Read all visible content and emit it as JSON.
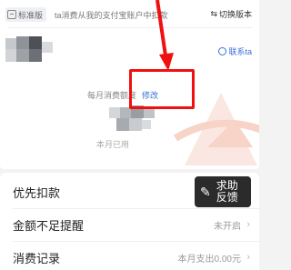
{
  "header": {
    "badge": "标准版",
    "description": "ta消费从我的支付宝账户中扣款",
    "switch_label": "切换版本"
  },
  "contact_label": "联系ta",
  "limit": {
    "label": "每月消费额度",
    "modify": "修改"
  },
  "month_spent_partial": "本月已用",
  "help_button": "求助反馈",
  "list": {
    "items": [
      {
        "title": "优先扣款",
        "value": ""
      },
      {
        "title": "金额不足提醒",
        "value": "未开启"
      },
      {
        "title": "消费记录",
        "value": "本月支出0.00元"
      }
    ]
  },
  "colors": {
    "accent_link": "#3a6fd8",
    "highlight": "#f01010"
  }
}
